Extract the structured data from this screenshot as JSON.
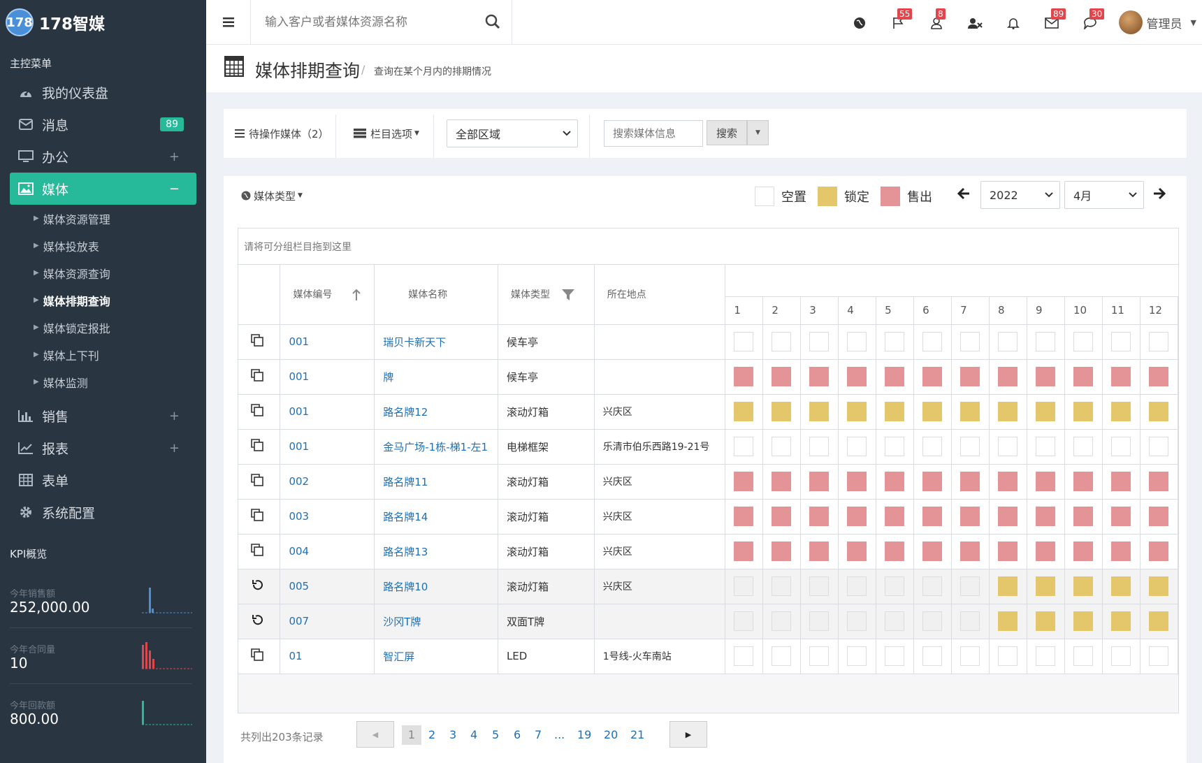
{
  "app": {
    "logo_mark": "178",
    "name": "178智媒"
  },
  "sidebar": {
    "section_title": "主控菜单",
    "items": [
      {
        "label": "我的仪表盘",
        "icon": "dashboard-icon"
      },
      {
        "label": "消息",
        "icon": "envelope-icon",
        "badge": "89"
      },
      {
        "label": "办公",
        "icon": "desktop-icon",
        "toggle": "+"
      },
      {
        "label": "媒体",
        "icon": "image-icon",
        "toggle": "−"
      },
      {
        "label": "销售",
        "icon": "bar-chart-icon",
        "toggle": "+"
      },
      {
        "label": "报表",
        "icon": "line-chart-icon",
        "toggle": "+"
      },
      {
        "label": "表单",
        "icon": "table-icon"
      },
      {
        "label": "系统配置",
        "icon": "gear-icon"
      }
    ],
    "sub_items": [
      "媒体资源管理",
      "媒体投放表",
      "媒体资源查询",
      "媒体排期查询",
      "媒体锁定报批",
      "媒体上下刊",
      "媒体监测"
    ],
    "kpi_title": "KPI概览",
    "kpis": [
      {
        "label": "今年销售额",
        "value": "252,000.00",
        "color": "#4a90d9"
      },
      {
        "label": "今年合同量",
        "value": "10",
        "color": "#e0464b"
      },
      {
        "label": "今年回款额",
        "value": "800.00",
        "color": "#26b99a"
      }
    ]
  },
  "topbar": {
    "search_placeholder": "输入客户或者媒体资源名称",
    "icons": [
      {
        "name": "globe-icon",
        "badge": ""
      },
      {
        "name": "flag-icon",
        "badge": "55"
      },
      {
        "name": "user-icon",
        "badge": "8"
      },
      {
        "name": "user-remove-icon",
        "badge": ""
      },
      {
        "name": "bell-icon",
        "badge": ""
      },
      {
        "name": "mail-icon",
        "badge": "89"
      },
      {
        "name": "comment-icon",
        "badge": "30"
      }
    ],
    "user_name": "管理员"
  },
  "page": {
    "title": "媒体排期查询",
    "separator": "/",
    "subtitle": "查询在某个月内的排期情况"
  },
  "toolbar": {
    "pending_label": "待操作媒体（2）",
    "columns_label": "栏目选项",
    "region_value": "全部区域",
    "media_search_placeholder": "搜索媒体信息",
    "search_button": "搜索"
  },
  "filter": {
    "media_type_label": "媒体类型",
    "legend": [
      {
        "label": "空置",
        "color": "#ffffff"
      },
      {
        "label": "锁定",
        "color": "#e5c76b"
      },
      {
        "label": "售出",
        "color": "#e49496"
      }
    ],
    "year": "2022",
    "month": "4月"
  },
  "grid": {
    "drop_zone": "请将可分组栏目拖到这里",
    "columns": [
      "媒体编号",
      "媒体名称",
      "媒体类型",
      "所在地点"
    ],
    "days": [
      "1",
      "2",
      "3",
      "4",
      "5",
      "6",
      "7",
      "8",
      "9",
      "10",
      "11",
      "12"
    ],
    "rows": [
      {
        "id": "001",
        "name": "瑞贝卡新天下",
        "type": "候车亭",
        "location": "",
        "action": "copy-icon",
        "dim": false,
        "status": "EEEEEEEEEEEE"
      },
      {
        "id": "001",
        "name": "牌",
        "type": "候车亭",
        "location": "",
        "action": "copy-icon",
        "dim": false,
        "status": "SSSSSSSSSSSS"
      },
      {
        "id": "001",
        "name": "路名牌12",
        "type": "滚动灯箱",
        "location": "兴庆区",
        "action": "copy-icon",
        "dim": false,
        "status": "LLLLLLLLLLLL"
      },
      {
        "id": "001",
        "name": "金马广场-1栋-梯1-左1",
        "type": "电梯框架",
        "location": "乐清市伯乐西路19-21号",
        "action": "copy-icon",
        "dim": false,
        "status": "EEEEEEEEEEEE"
      },
      {
        "id": "002",
        "name": "路名牌11",
        "type": "滚动灯箱",
        "location": "兴庆区",
        "action": "copy-icon",
        "dim": false,
        "status": "SSSSSSSSSSSS"
      },
      {
        "id": "003",
        "name": "路名牌14",
        "type": "滚动灯箱",
        "location": "兴庆区",
        "action": "copy-icon",
        "dim": false,
        "status": "SSSSSSSSSSSS"
      },
      {
        "id": "004",
        "name": "路名牌13",
        "type": "滚动灯箱",
        "location": "兴庆区",
        "action": "copy-icon",
        "dim": false,
        "status": "SSSSSSSSSSSS"
      },
      {
        "id": "005",
        "name": "路名牌10",
        "type": "滚动灯箱",
        "location": "兴庆区",
        "action": "undo-icon",
        "dim": true,
        "status": "GGGGGGGLLLLL"
      },
      {
        "id": "007",
        "name": "沙冈T牌",
        "type": "双面T牌",
        "location": "",
        "action": "undo-icon",
        "dim": true,
        "status": "GGGGGGGLLLLL"
      },
      {
        "id": "01",
        "name": "智汇屏",
        "type": "LED",
        "location": "1号线-火车南站",
        "action": "copy-icon",
        "dim": false,
        "status": "EEEEEEEEEEEE"
      }
    ]
  },
  "pager": {
    "total": "共列出203条记录",
    "pages": [
      "1",
      "2",
      "3",
      "4",
      "5",
      "6",
      "7",
      "...",
      "19",
      "20",
      "21"
    ],
    "current": "1"
  }
}
